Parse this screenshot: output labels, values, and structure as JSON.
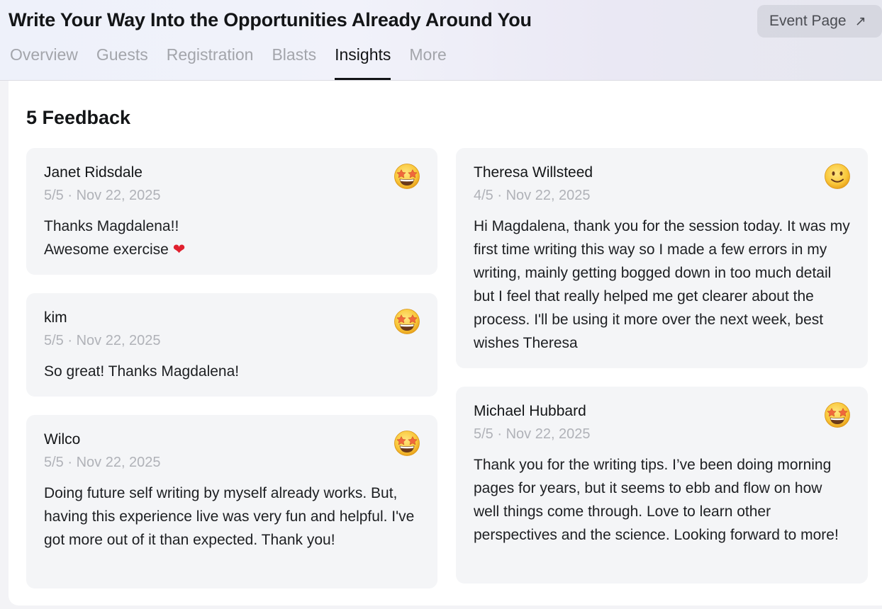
{
  "header": {
    "title": "Write Your Way Into the Opportunities Already Around You",
    "event_page_label": "Event Page",
    "event_page_icon": "arrow-up-right-icon"
  },
  "tabs": [
    {
      "label": "Overview",
      "active": false
    },
    {
      "label": "Guests",
      "active": false
    },
    {
      "label": "Registration",
      "active": false
    },
    {
      "label": "Blasts",
      "active": false
    },
    {
      "label": "Insights",
      "active": true
    },
    {
      "label": "More",
      "active": false
    }
  ],
  "feedback": {
    "heading": "5 Feedback",
    "items": [
      {
        "name": "Janet Ridsdale",
        "meta": "5/5 · Nov 22, 2025",
        "text_line1": "Thanks Magdalena!!",
        "text_line2": "Awesome exercise",
        "heart": "❤",
        "emoji": "star-struck-emoji-icon"
      },
      {
        "name": "kim",
        "meta": "5/5 · Nov 22, 2025",
        "text": "So great! Thanks Magdalena!",
        "emoji": "star-struck-emoji-icon"
      },
      {
        "name": "Wilco",
        "meta": "5/5 · Nov 22, 2025",
        "text": "Doing future self writing by myself already works. But, having this experience live was very fun and helpful. I've got more out of it than expected. Thank you!",
        "emoji": "star-struck-emoji-icon"
      },
      {
        "name": "Theresa Willsteed",
        "meta": "4/5 · Nov 22, 2025",
        "text": "Hi Magdalena, thank you for the session today. It was my first time writing this way so I made a few errors in my writing, mainly getting bogged down in too much detail but I feel that really helped me get clearer about the process. I'll be using it more over the next week, best wishes Theresa",
        "emoji": "slightly-smiling-emoji-icon"
      },
      {
        "name": "Michael Hubbard",
        "meta": "5/5 · Nov 22, 2025",
        "text": "Thank you for the writing tips. I’ve been doing morning pages for years, but it seems to ebb and flow on how well things come through. Love to learn other perspectives and the science. Looking forward to more!",
        "emoji": "star-struck-emoji-icon"
      }
    ]
  },
  "colors": {
    "active_tab": "#131517",
    "inactive_tab": "#a3a5ab",
    "card_bg": "#f4f5f7",
    "meta_text": "#b0b2b8"
  }
}
